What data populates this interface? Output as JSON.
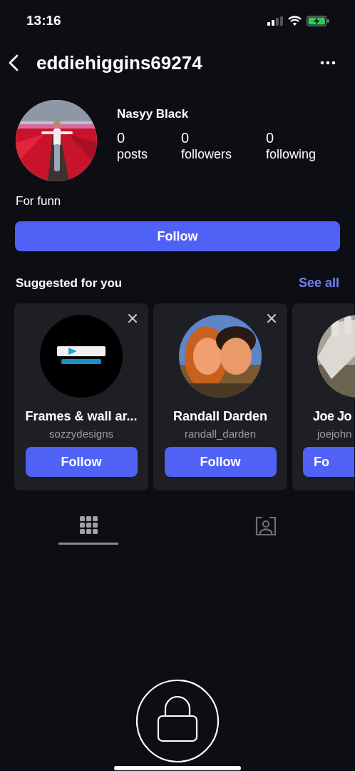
{
  "status_bar": {
    "time": "13:16"
  },
  "header": {
    "username": "eddiehiggins69274"
  },
  "profile": {
    "name": "Nasyy Black",
    "stats": [
      {
        "value": "0",
        "label": "posts"
      },
      {
        "value": "0",
        "label": "followers"
      },
      {
        "value": "0",
        "label": "following"
      }
    ],
    "bio": "For funn",
    "follow_button": "Follow"
  },
  "suggested": {
    "title": "Suggested for you",
    "see_all": "See all",
    "cards": [
      {
        "name": "Frames & wall ar...",
        "handle": "sozzydesigns",
        "button": "Follow",
        "dismissible": true,
        "kind": "logo"
      },
      {
        "name": "Randall Darden",
        "handle": "randall_darden",
        "button": "Follow",
        "dismissible": true,
        "kind": "couple"
      },
      {
        "name": "Joe Jo",
        "handle": "joejohn",
        "button": "Fo",
        "dismissible": false,
        "kind": "hand"
      }
    ]
  },
  "tabs": [
    {
      "kind": "grid",
      "selected": true
    },
    {
      "kind": "tagged",
      "selected": false
    }
  ]
}
